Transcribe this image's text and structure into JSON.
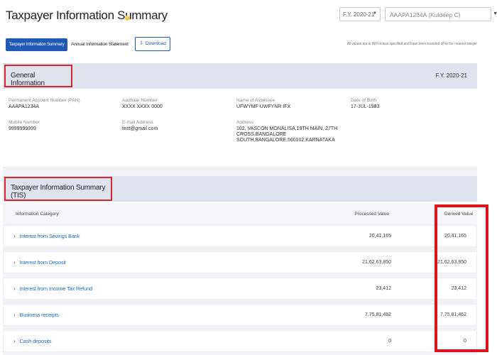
{
  "header": {
    "title": "Taxpayer Information Summary",
    "fy_select": "F.Y. 2020-21",
    "pan_select": "AAAPA1234A (Kuldeep C)"
  },
  "tabs": {
    "active": "Taxpayer Information Summary",
    "inactive": "Annual Information Statement",
    "download": "Download"
  },
  "note": "All values are in INR unless specified and have been rounded off to the nearest integer",
  "general": {
    "title": "General Information",
    "fy": "F.Y. 2020-21",
    "pan_label": "Permanent Account Number (PAN)",
    "pan_value": "AAAPA1234A",
    "aadhaar_label": "Aadhaar Number",
    "aadhaar_value": "XXXX XXXX 0000",
    "name_label": "Name of Assessee",
    "name_value": "UFWYMF UWFYNR IFX",
    "dob_label": "Date of Birth",
    "dob_value": "17-JUL-1983",
    "mobile_label": "Mobile Number",
    "mobile_value": "9999999999",
    "email_label": "E-mail Address",
    "email_value": "test@gmail.com",
    "address_label": "Address",
    "address_value": "102, VASCON MONALISA,19TH MAIN, 27TH CROSS,BANGALORE SOUTH,BANGALORE,560102,KARNATAKA"
  },
  "tis": {
    "title": "Taxpayer Information Summary (TIS)",
    "col_category": "Information Category",
    "col_processed": "Processed Value",
    "col_derived": "Derived Value",
    "rows": [
      {
        "category": "Interest from Savings Bank",
        "processed": "20,41,165",
        "derived": "20,41,165"
      },
      {
        "category": "Interest from Deposit",
        "processed": "21,62,63,850",
        "derived": "21,62,63,850"
      },
      {
        "category": "Interest from Income Tax Refund",
        "processed": "23,412",
        "derived": "23,412"
      },
      {
        "category": "Business receipts",
        "processed": "7,75,81,462",
        "derived": "7,75,81,462"
      },
      {
        "category": "Cash deposits",
        "processed": "0",
        "derived": "0"
      }
    ]
  },
  "colors": {
    "primary": "#1f5bb5",
    "highlight": "#e0121c",
    "band": "#dfe3ee",
    "link": "#2a6fc9"
  }
}
